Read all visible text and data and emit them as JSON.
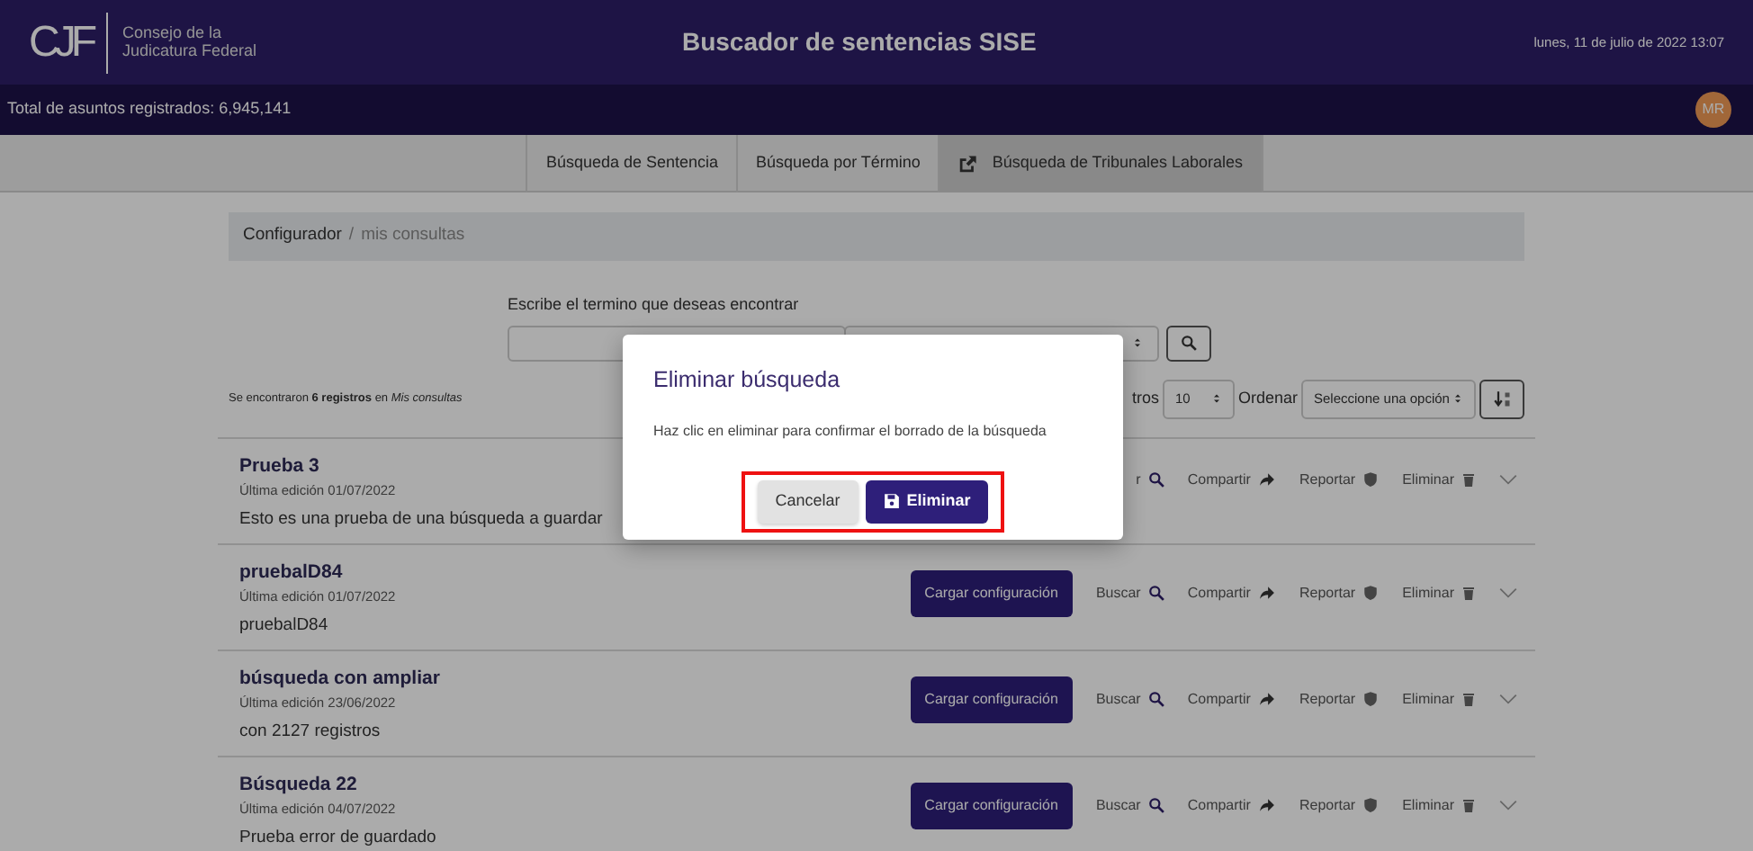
{
  "header": {
    "logo": "CJF",
    "org_line1": "Consejo de la",
    "org_line2": "Judicatura Federal",
    "title": "Buscador de sentencias SISE",
    "date": "lunes, 11 de julio de 2022 13:07"
  },
  "info_bar": {
    "total": "Total de asuntos registrados: 6,945,141",
    "avatar": "MR"
  },
  "tabs": [
    {
      "label": "Búsqueda de Sentencia",
      "selected": false,
      "external": false
    },
    {
      "label": "Búsqueda por Término",
      "selected": false,
      "external": false
    },
    {
      "label": "Búsqueda de Tribunales Laborales",
      "selected": true,
      "external": true
    }
  ],
  "breadcrumb": {
    "separator": "/",
    "items": [
      {
        "label": "Configurador",
        "active": false
      },
      {
        "label": "mis consultas",
        "active": true
      }
    ]
  },
  "search": {
    "label": "Escribe el termino que deseas encontrar"
  },
  "results": {
    "summary": "Se encontraron **6 registros** en *Mis consultas*",
    "page_size_label": "tros",
    "page_size": "10",
    "sort_label": "Ordenar",
    "sort_select": "Seleccione una opción"
  },
  "rows": [
    {
      "title": "Prueba 3",
      "edited": "Última edición 01/07/2022",
      "description": "Esto es una prueba de una búsqueda a guardar",
      "actions": [
        {
          "kind": "search",
          "label": "r"
        },
        {
          "kind": "share",
          "label": "Compartir"
        },
        {
          "kind": "report",
          "label": "Reportar"
        },
        {
          "kind": "delete",
          "label": "Eliminar"
        }
      ]
    },
    {
      "title": "pruebalD84",
      "edited": "Última edición 01/07/2022",
      "description": "pruebalD84",
      "load_button": "Cargar configuración",
      "actions": [
        {
          "kind": "search",
          "label": "Buscar"
        },
        {
          "kind": "share",
          "label": "Compartir"
        },
        {
          "kind": "report",
          "label": "Reportar"
        },
        {
          "kind": "delete",
          "label": "Eliminar"
        }
      ]
    },
    {
      "title": "búsqueda con ampliar",
      "edited": "Última edición 23/06/2022",
      "description": "con 2127 registros",
      "load_button": "Cargar configuración",
      "actions": [
        {
          "kind": "search",
          "label": "Buscar"
        },
        {
          "kind": "share",
          "label": "Compartir"
        },
        {
          "kind": "report",
          "label": "Reportar"
        },
        {
          "kind": "delete",
          "label": "Eliminar"
        }
      ]
    },
    {
      "title": "Búsqueda 22",
      "edited": "Última edición 04/07/2022",
      "description": "Prueba error de guardado",
      "load_button": "Cargar configuración",
      "actions": [
        {
          "kind": "search",
          "label": "Buscar"
        },
        {
          "kind": "share",
          "label": "Compartir"
        },
        {
          "kind": "report",
          "label": "Reportar"
        },
        {
          "kind": "delete",
          "label": "Eliminar"
        }
      ]
    }
  ],
  "modal": {
    "title": "Eliminar búsqueda",
    "message": "Haz clic en eliminar para confirmar el borrado de la búsqueda",
    "highlight": true,
    "buttons": [
      {
        "kind": "secondary",
        "label": "Cancelar"
      },
      {
        "kind": "primary",
        "label": "Eliminar"
      }
    ]
  }
}
